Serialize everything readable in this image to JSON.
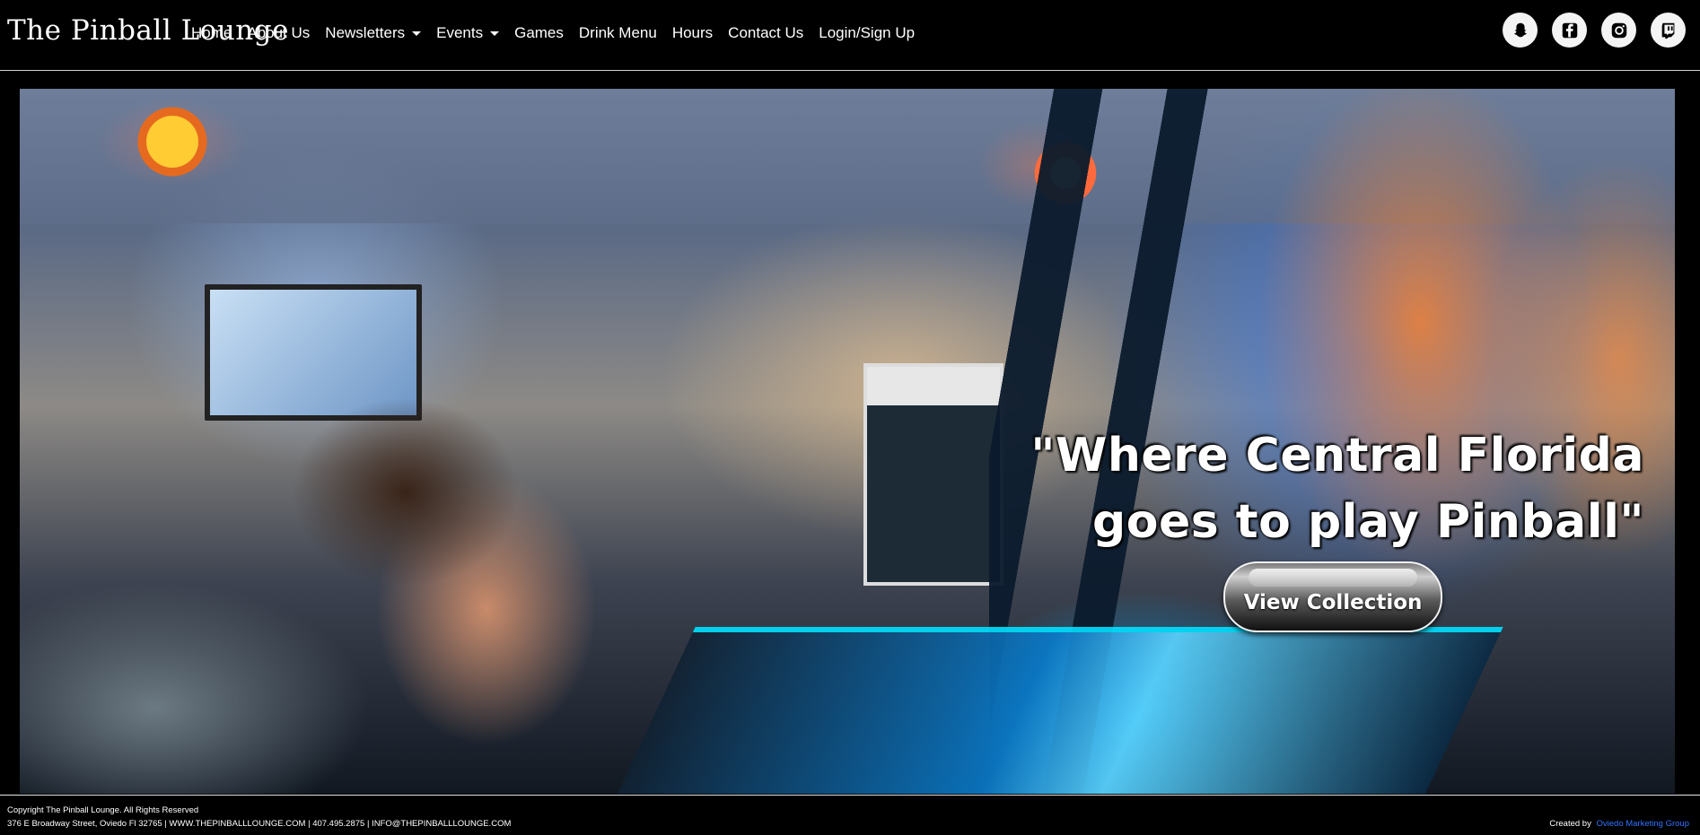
{
  "header": {
    "logo_text": "The Pinball Lounge",
    "nav": [
      {
        "label": "Home"
      },
      {
        "label": "About Us"
      },
      {
        "label": "Newsletters",
        "dropdown": true
      },
      {
        "label": "Events",
        "dropdown": true
      },
      {
        "label": "Games"
      },
      {
        "label": "Drink Menu"
      },
      {
        "label": "Hours"
      },
      {
        "label": "Contact Us"
      },
      {
        "label": "Login/Sign Up"
      }
    ],
    "social": [
      "snapchat-icon",
      "facebook-icon",
      "instagram-icon",
      "twitch-icon"
    ]
  },
  "hero": {
    "headline_line1": "\"Where Central Florida",
    "headline_line2": "goes to play Pinball\"",
    "button_label": "View Collection"
  },
  "footer": {
    "copyright": "Copyright The Pinball Lounge. All Rights Reserved",
    "address_line": "376 E Broadway Street, Oviedo Fl 32765 | WWW.THEPINBALLLOUNGE.COM | 407.495.2875 | INFO@THEPINBALLLOUNGE.COM",
    "created_by_label": "Created by",
    "created_by_link": "Oviedo Marketing Group"
  },
  "colors": {
    "background": "#000000",
    "text": "#ffffff",
    "link": "#2f74ff"
  }
}
